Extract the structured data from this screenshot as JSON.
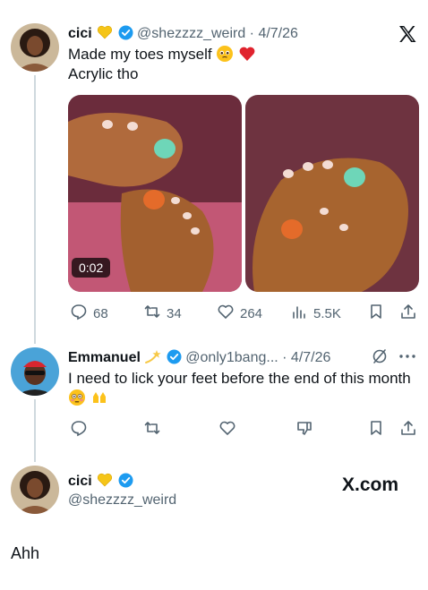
{
  "tweet1": {
    "name": "cici",
    "handle": "@shezzzz_weird",
    "date": "4/7/26",
    "line1": "Made my toes myself",
    "line2": "Acrylic tho",
    "video_time": "0:02",
    "actions": {
      "replies": "68",
      "retweets": "34",
      "likes": "264",
      "views": "5.5K"
    }
  },
  "tweet2": {
    "name": "Emmanuel",
    "handle": "@only1bang...",
    "date": "4/7/26",
    "text": "I need to lick your feet before the end of this month"
  },
  "footer": {
    "name": "cici",
    "handle": "@shezzzz_weird",
    "brand": "X.com"
  },
  "caption": "Ahh",
  "icons": [
    "x-logo-icon",
    "verified-icon",
    "gold-heart-icon",
    "pleading-face-icon",
    "red-heart-icon",
    "reply-icon",
    "retweet-icon",
    "like-icon",
    "views-icon",
    "bookmark-icon",
    "share-icon",
    "grok-icon",
    "more-icon",
    "downvote-icon",
    "flushed-face-icon",
    "hands-icon",
    "shooting-star-icon"
  ],
  "colors": {
    "accent": "#1d9bf0",
    "text": "#0f1419",
    "muted": "#536471"
  }
}
